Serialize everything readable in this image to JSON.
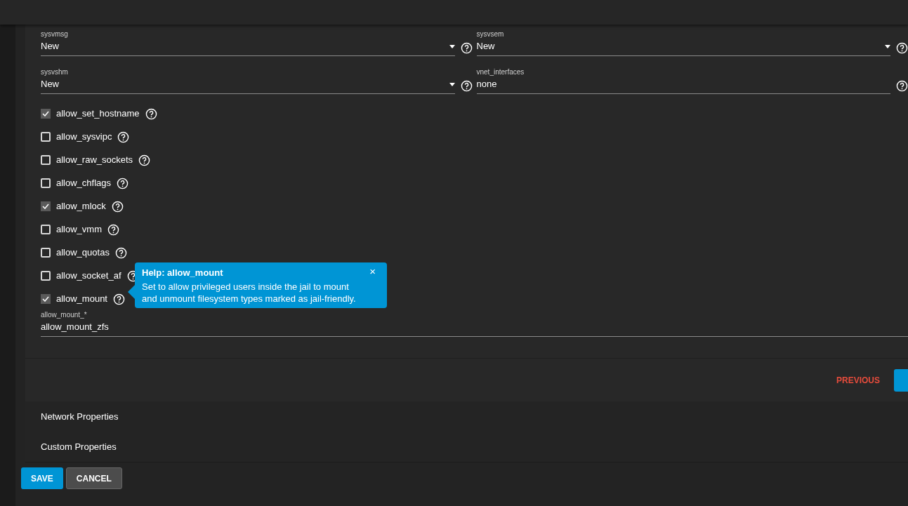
{
  "selects": [
    {
      "label": "sysvmsg",
      "value": "New",
      "kind": "select"
    },
    {
      "label": "sysvsem",
      "value": "New",
      "kind": "select"
    },
    {
      "label": "sysvshm",
      "value": "New",
      "kind": "select"
    },
    {
      "label": "vnet_interfaces",
      "value": "none",
      "kind": "text"
    }
  ],
  "checkboxes": [
    {
      "label": "allow_set_hostname",
      "checked": true
    },
    {
      "label": "allow_sysvipc",
      "checked": false
    },
    {
      "label": "allow_raw_sockets",
      "checked": false
    },
    {
      "label": "allow_chflags",
      "checked": false
    },
    {
      "label": "allow_mlock",
      "checked": true
    },
    {
      "label": "allow_vmm",
      "checked": false
    },
    {
      "label": "allow_quotas",
      "checked": false
    },
    {
      "label": "allow_socket_af",
      "checked": false
    },
    {
      "label": "allow_mount",
      "checked": true
    }
  ],
  "tooltip": {
    "title": "Help: allow_mount",
    "text": "Set to allow privileged users inside the jail to mount and unmount filesystem types marked as jail-friendly.",
    "close": "×"
  },
  "mount_field": {
    "label": "allow_mount_*",
    "value": "allow_mount_zfs"
  },
  "previous_button": "PREVIOUS",
  "sections": [
    "Network Properties",
    "Custom Properties"
  ],
  "buttons": [
    {
      "label": "SAVE",
      "kind": "primary"
    },
    {
      "label": "CANCEL",
      "kind": "secondary"
    }
  ]
}
